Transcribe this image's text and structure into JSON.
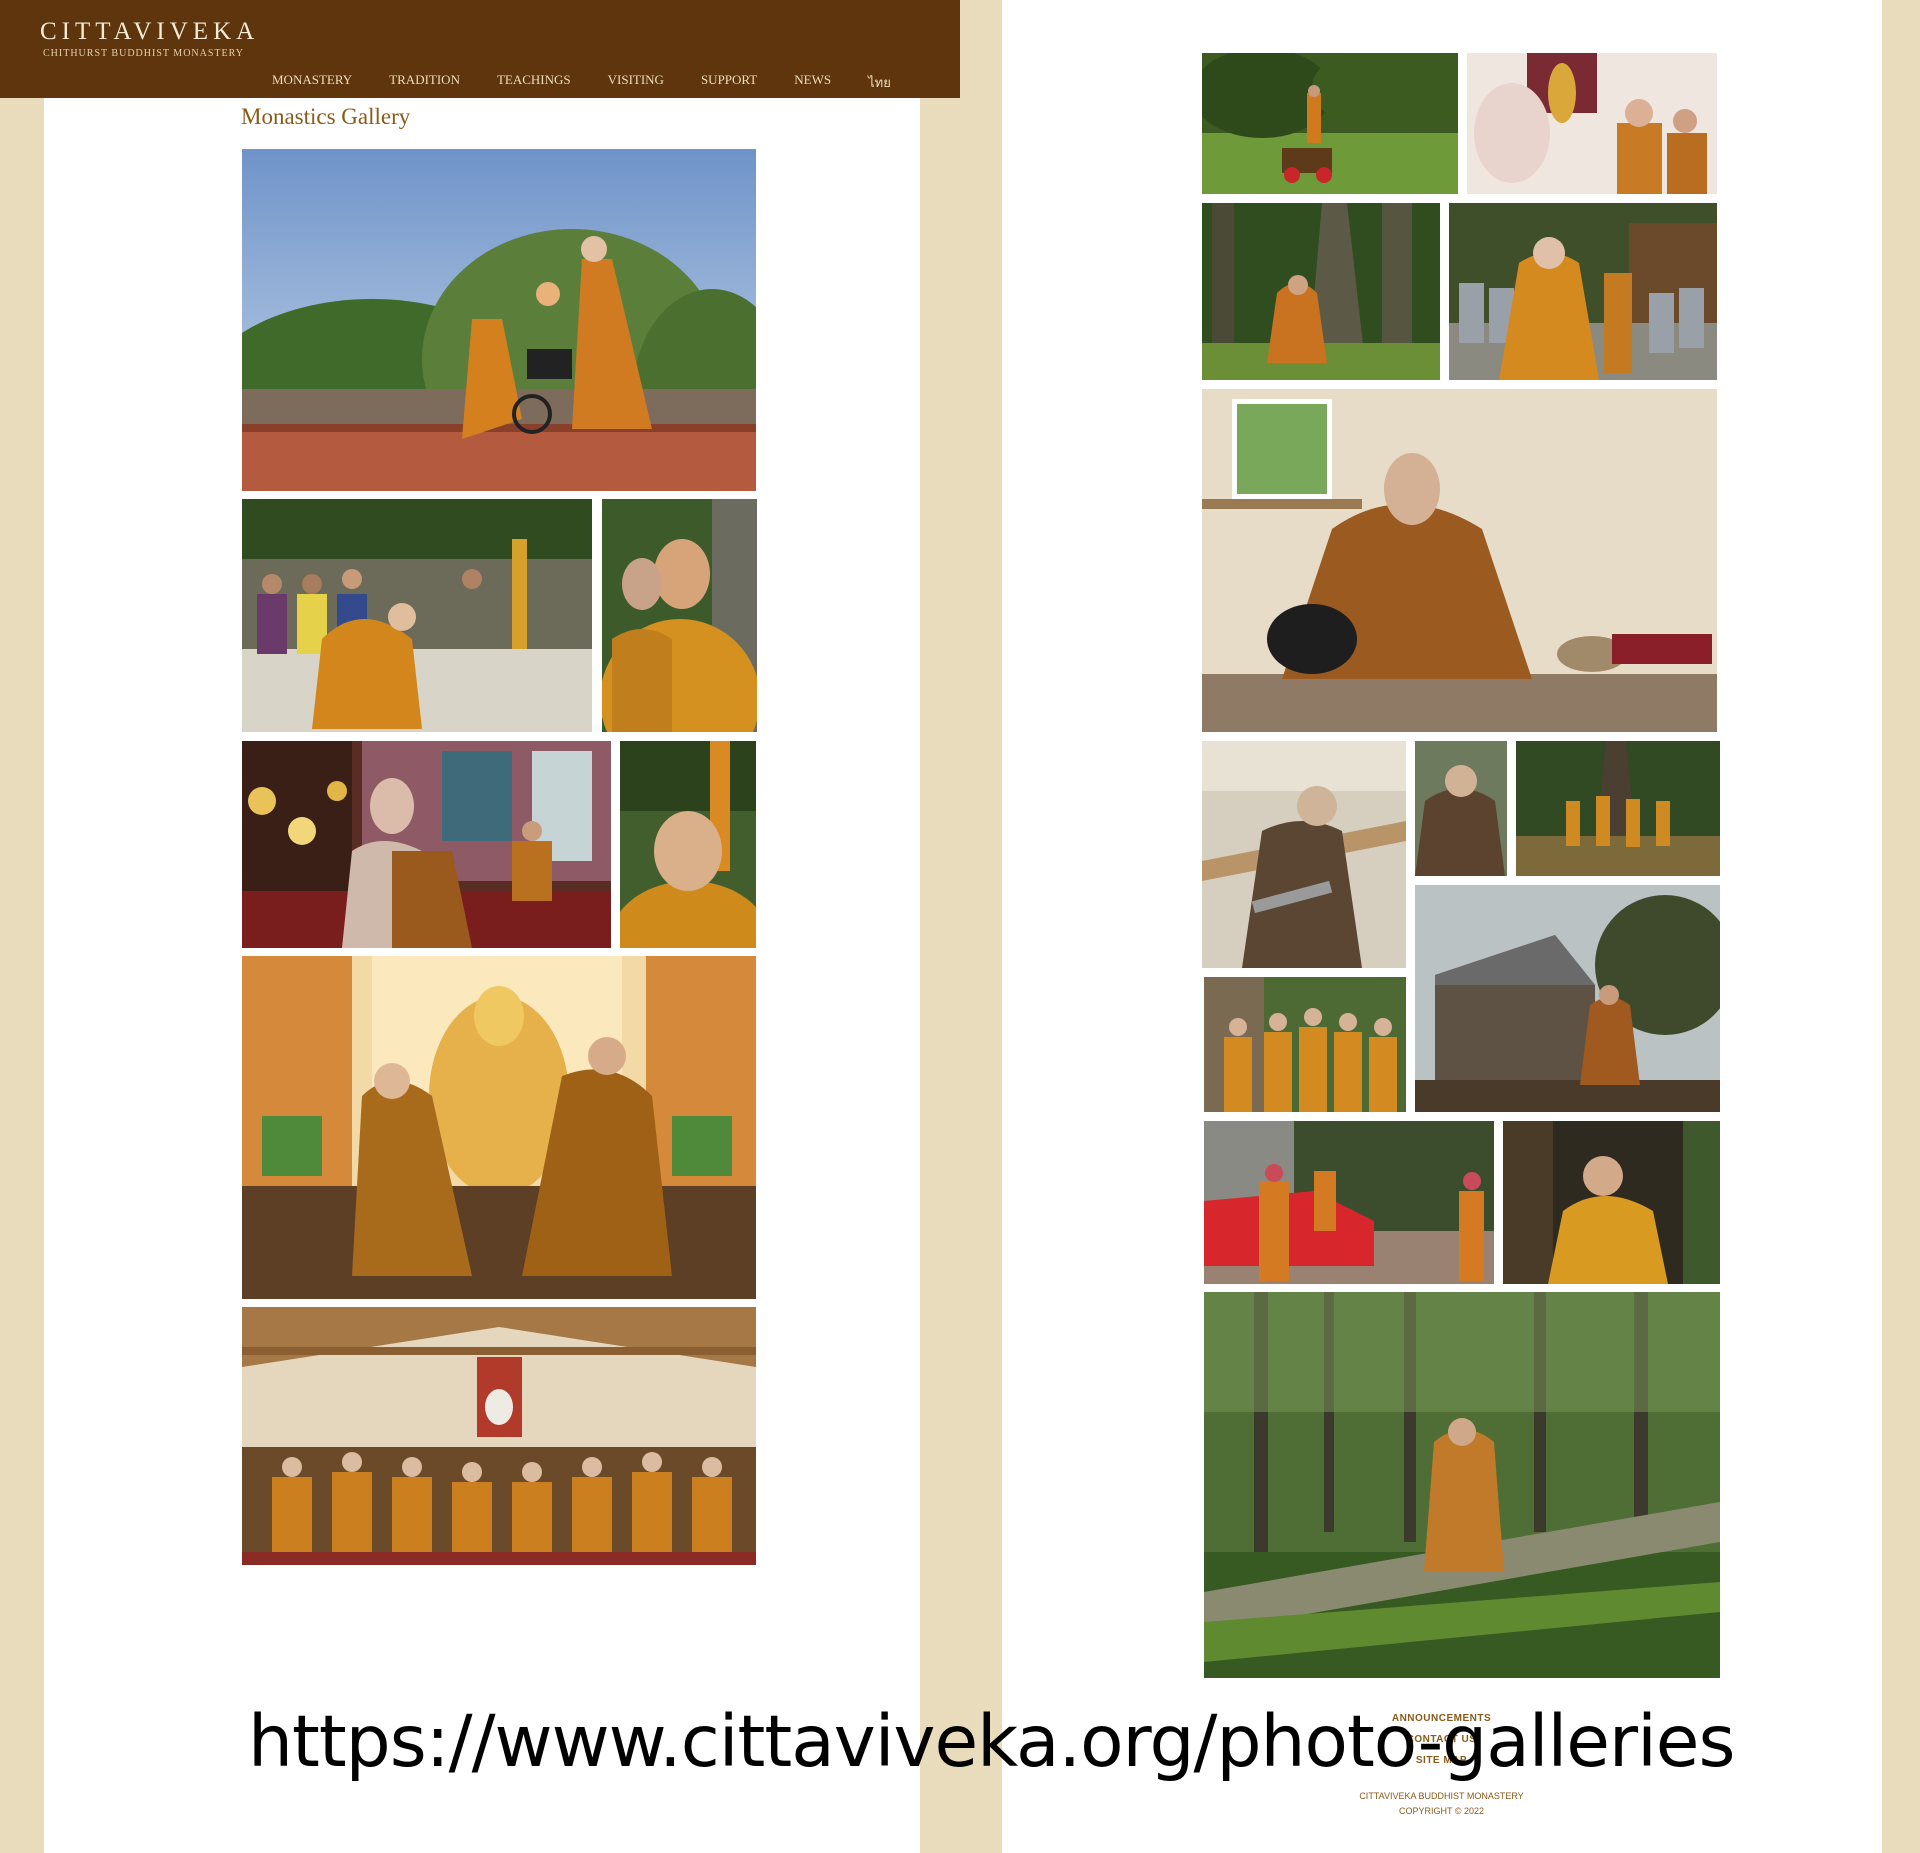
{
  "site": {
    "title": "CITTAVIVEKA",
    "subtitle": "CHITHURST BUDDHIST MONASTERY"
  },
  "nav": [
    "MONASTERY",
    "TRADITION",
    "TEACHINGS",
    "VISITING",
    "SUPPORT",
    "NEWS",
    "ไทย"
  ],
  "page": {
    "title": "Monastics Gallery"
  },
  "gallery_left": [
    {
      "subject": "monk-pushing-wheelchair-photo"
    },
    {
      "subject": "monk-bowing-crowd-photo"
    },
    {
      "subject": "monks-smiling-photo"
    },
    {
      "subject": "shrine-room-monks-photo"
    },
    {
      "subject": "smiling-monk-portrait-photo"
    },
    {
      "subject": "monks-kneeling-buddha-photo"
    },
    {
      "subject": "assembly-hall-group-photo"
    }
  ],
  "gallery_right": [
    {
      "subject": "monk-in-park-photo"
    },
    {
      "subject": "monks-at-shrine-photo"
    },
    {
      "subject": "monk-sitting-tree-photo"
    },
    {
      "subject": "alms-round-photo"
    },
    {
      "subject": "monk-meditating-room-photo"
    },
    {
      "subject": "monk-woodwork-photo"
    },
    {
      "subject": "nun-portrait-photo"
    },
    {
      "subject": "monks-under-tree-photo"
    },
    {
      "subject": "monk-at-hut-photo"
    },
    {
      "subject": "monks-gathering-photo"
    },
    {
      "subject": "monks-by-red-car-photo"
    },
    {
      "subject": "monk-in-hollow-tree-photo"
    },
    {
      "subject": "monk-on-fallen-log-photo"
    }
  ],
  "footer": {
    "links": [
      "ANNOUNCEMENTS",
      "CONTACT US",
      "SITE MAP"
    ],
    "name": "CITTAVIVEKA BUDDHIST MONASTERY",
    "copyright": "COPYRIGHT © 2022"
  },
  "url_overlay": "https://www.cittaviveka.org/photo-galleries"
}
